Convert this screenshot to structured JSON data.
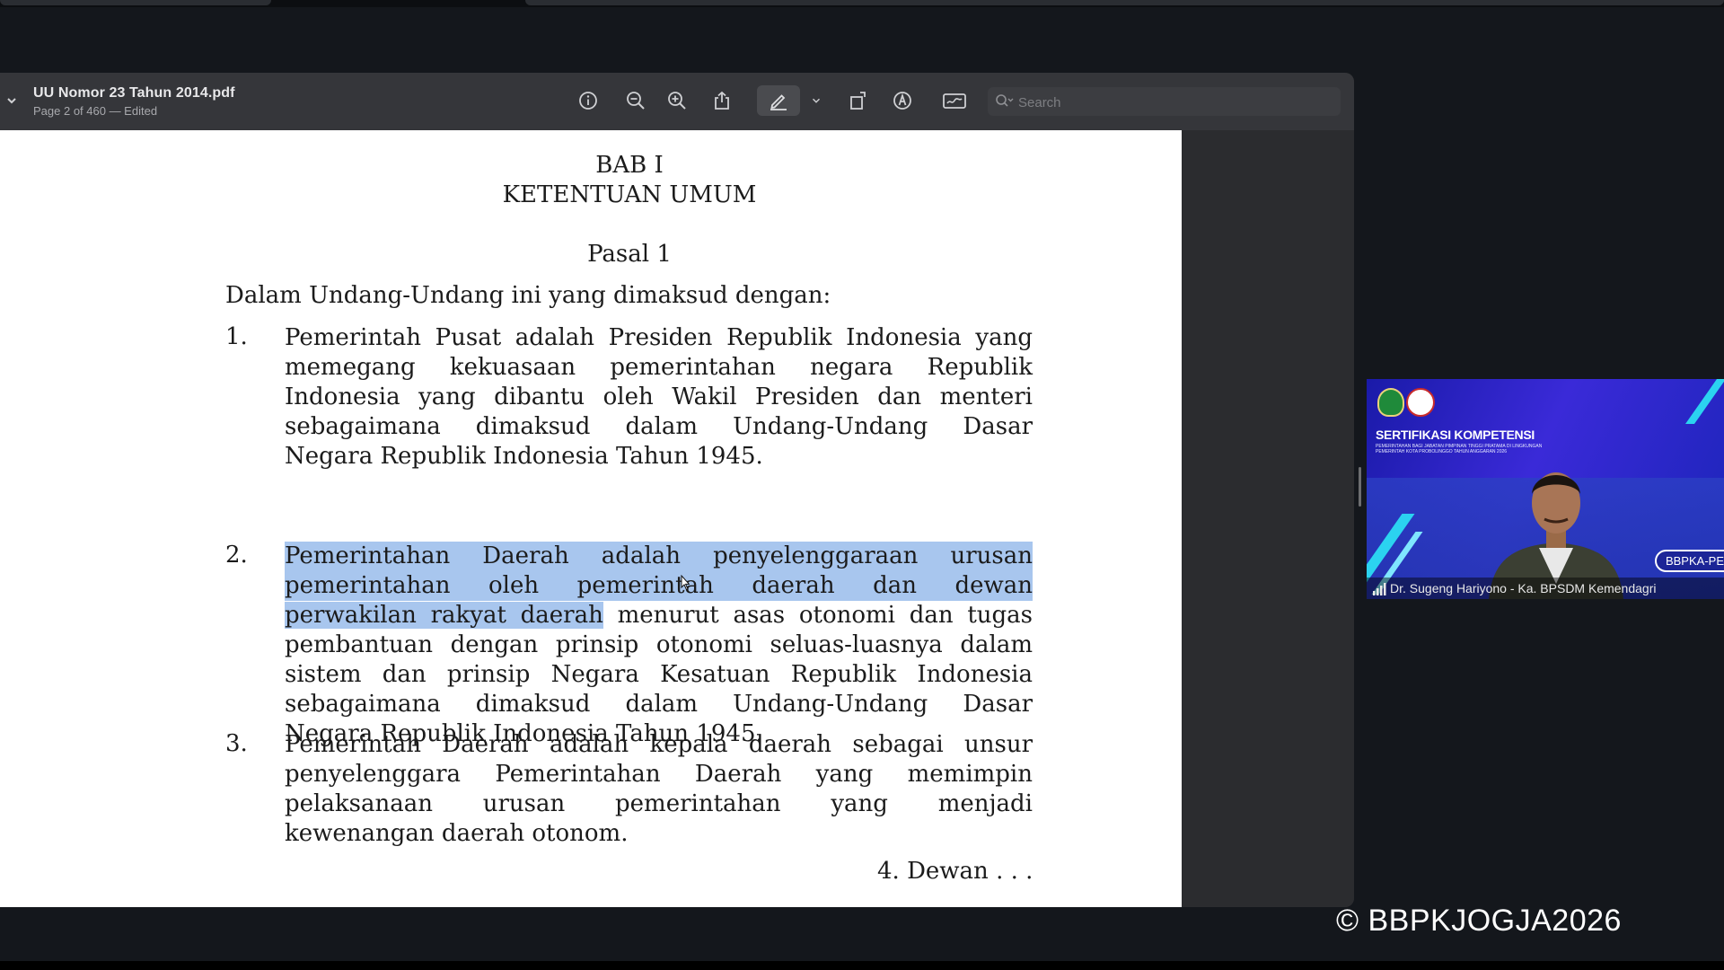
{
  "window": {
    "doc_title": "UU Nomor 23 Tahun 2014.pdf",
    "doc_subtitle": "Page 2 of 460 — Edited"
  },
  "toolbar": {
    "search_placeholder": "Search",
    "icons": [
      "info-icon",
      "zoom-out-icon",
      "zoom-in-icon",
      "share-icon",
      "highlight-pen-icon",
      "chevron-down-icon",
      "rotate-icon",
      "markup-icon",
      "signature-icon",
      "search-icon"
    ]
  },
  "document": {
    "heading1": "BAB I",
    "heading2": "KETENTUAN UMUM",
    "pasal": "Pasal 1",
    "intro": "Dalam Undang-Undang ini yang dimaksud dengan:",
    "items": [
      {
        "num": "1.",
        "lines": [
          "Pemerintah Pusat adalah Presiden Republik Indonesia yang",
          "memegang kekuasaan pemerintahan negara Republik",
          "Indonesia yang dibantu oleh Wakil Presiden dan menteri",
          "sebagaimana dimaksud dalam Undang-Undang Dasar",
          "Negara Republik Indonesia Tahun 1945."
        ]
      },
      {
        "num": "2.",
        "highlight_1": "Pemerintahan Daerah adalah penyelenggaraan urusan",
        "highlight_2": "pemerintahan oleh pemerintah daerah dan dewan",
        "highlight_3": "perwakilan rakyat daerah",
        "rest_3": " menurut asas otonomi dan tugas",
        "lines_after": [
          "pembantuan dengan prinsip otonomi seluas-luasnya dalam",
          "sistem dan prinsip Negara Kesatuan Republik Indonesia",
          "sebagaimana dimaksud dalam Undang-Undang Dasar",
          "Negara Republik Indonesia Tahun 1945."
        ]
      },
      {
        "num": "3.",
        "lines": [
          "Pemerintah Daerah adalah kepala daerah sebagai unsur",
          "penyelenggara Pemerintahan Daerah yang memimpin",
          "pelaksanaan urusan pemerintahan yang menjadi",
          "kewenangan daerah otonom."
        ]
      }
    ],
    "continuation": "4. Dewan . . ."
  },
  "video": {
    "title": "SERTIFIKASI KOMPETENSI",
    "subtitle": "PEMERINTAHAN BAGI JABATAN PIMPINAN TINGGI PRATAMA DI LINGKUNGAN PEMERINTAH KOTA PROBOLINGGO TAHUN ANGGARAN 2026",
    "badge": "BBPKA-PE",
    "participant": "Dr. Sugeng Hariyono - Ka. BPSDM Kemendagri"
  },
  "watermark": "© BBPKJOGJA2026"
}
